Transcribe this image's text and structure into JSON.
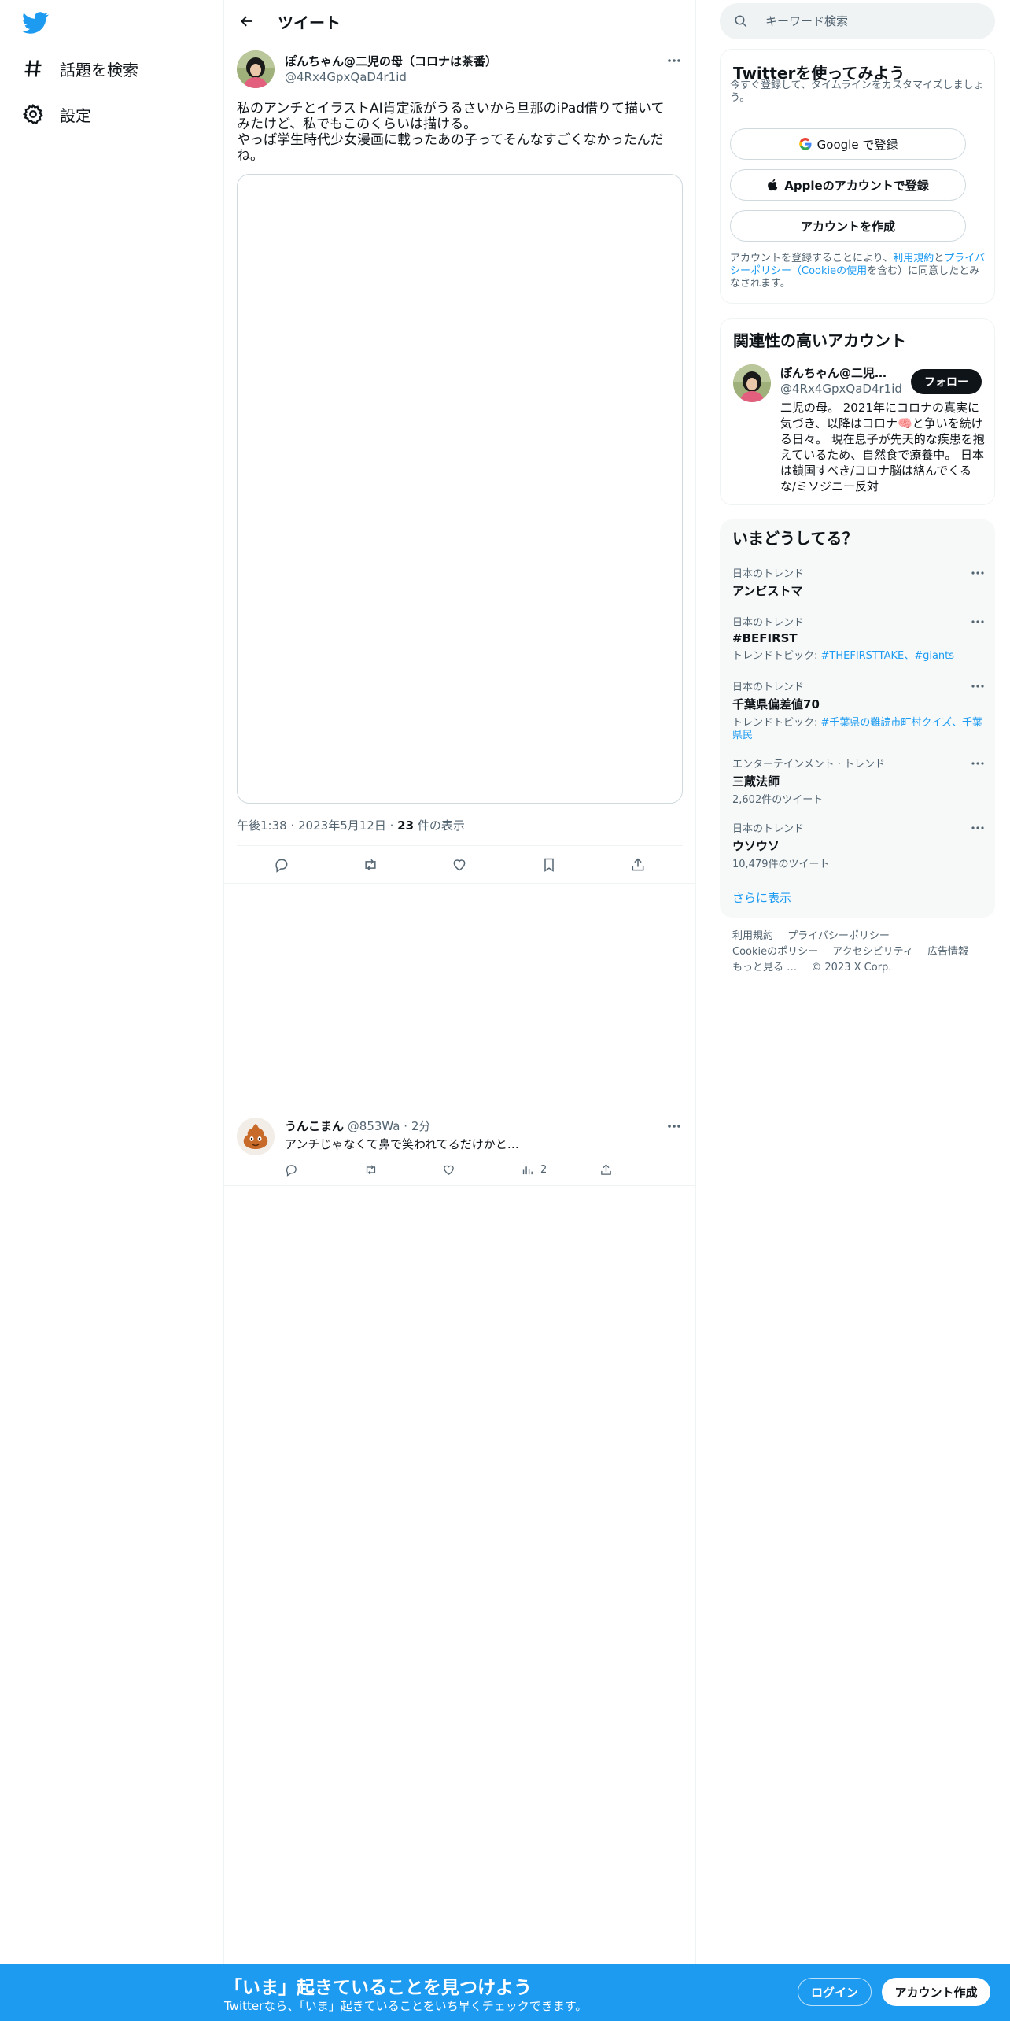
{
  "nav": {
    "logo": "twitter-bird-icon",
    "items": [
      {
        "label": "話題を検索",
        "icon": "hashtag-icon"
      },
      {
        "label": "設定",
        "icon": "gear-icon"
      }
    ]
  },
  "header": {
    "title": "ツイート"
  },
  "tweet": {
    "author_name": "ぽんちゃん@二児の母（コロナは茶番）",
    "author_handle": "@4Rx4GpxQaD4r1id",
    "text": "私のアンチとイラストAI肯定派がうるさいから旦那のiPad借りて描いてみたけど、私でもこのくらいは描ける。\nやっぱ学生時代少女漫画に載ったあの子ってそんなすごくなかったんだね。",
    "time": "午後1:38",
    "date": "2023年5月12日",
    "views_count": "23",
    "views_label": "件の表示"
  },
  "reply": {
    "name": "うんこまん",
    "handle": "@853Wa",
    "time": "2分",
    "text": "アンチじゃなくて鼻で笑われてるだけかと…",
    "views": "2"
  },
  "search": {
    "placeholder": "キーワード検索"
  },
  "signup_card": {
    "title": "Twitterを使ってみよう",
    "subtitle": "今すぐ登録して、タイムラインをカスタマイズしましょう。",
    "google_label": "Google で登録",
    "apple_label": "Appleのアカウントで登録",
    "create_label": "アカウントを作成",
    "legal_pre": "アカウントを登録することにより、",
    "legal_terms": "利用規約",
    "legal_and": "と",
    "legal_privacy": "プライバシーポリシー（Cookieの使用",
    "legal_post": "を含む）に同意したとみなされます。"
  },
  "related": {
    "title": "関連性の高いアカウント",
    "name": "ぽんちゃん@二児の母（コロナは茶番）",
    "handle": "@4Rx4GpxQaD4r1id",
    "follow_label": "フォロー",
    "bio": "二児の母。 2021年にコロナの真実に気づき、以降はコロナ🧠と争いを続ける日々。 現在息子が先天的な疾患を抱えているため、自然食で療養中。 日本は鎖国すべき/コロナ脳は絡んでくるな/ミソジニー反対"
  },
  "trends": {
    "title": "いまどうしてる？",
    "items": [
      {
        "context": "日本のトレンド",
        "name": "アンビストマ"
      },
      {
        "context": "日本のトレンド",
        "name": "#BEFIRST",
        "topics_label": "トレンドトピック: ",
        "topics": "#THEFIRSTTAKE、#giants"
      },
      {
        "context": "日本のトレンド",
        "name": "千葉県偏差値70",
        "topics_label": "トレンドトピック: ",
        "topics": "#千葉県の難読市町村クイズ、千葉県民"
      },
      {
        "context": "エンターテインメント · トレンド",
        "name": "三蔵法師",
        "count": "2,602件のツイート"
      },
      {
        "context": "日本のトレンド",
        "name": "ウソウソ",
        "count": "10,479件のツイート"
      }
    ],
    "show_more": "さらに表示"
  },
  "footer": {
    "terms": "利用規約",
    "privacy": "プライバシーポリシー",
    "cookie": "Cookieのポリシー",
    "accessibility": "アクセシビリティ",
    "ads": "広告情報",
    "more": "もっと見る …",
    "copyright": "© 2023 X Corp."
  },
  "bottom_bar": {
    "title": "「いま」起きていることを見つけよう",
    "subtitle": "Twitterなら、「いま」起きていることをいち早くチェックできます。",
    "login_label": "ログイン",
    "signup_label": "アカウント作成"
  },
  "colors": {
    "accent": "#1d9bf0",
    "text": "#0f1419",
    "secondary": "#536471",
    "border": "#eff3f4"
  }
}
